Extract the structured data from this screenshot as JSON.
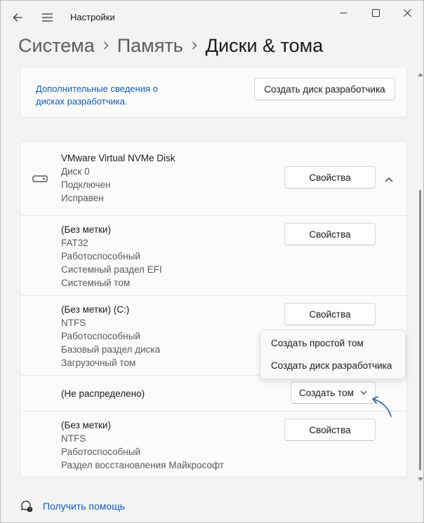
{
  "window": {
    "title": "Настройки"
  },
  "breadcrumb": {
    "items": [
      "Система",
      "Память"
    ],
    "current": "Диски & тома"
  },
  "dev_drive_card": {
    "link_text": "Дополнительные сведения о дисках разработчика.",
    "button_label": "Создать диск разработчика"
  },
  "disk": {
    "name": "VMware Virtual NVMe Disk",
    "number": "Диск 0",
    "status": "Подключен",
    "health": "Исправен",
    "properties_label": "Свойства",
    "partitions": [
      {
        "label": "(Без метки)",
        "fs": "FAT32",
        "status": "Работоспособный",
        "type": "Системный раздел EFI",
        "role": "Системный том",
        "button": "Свойства"
      },
      {
        "label": "(Без метки) (C:)",
        "fs": "NTFS",
        "status": "Работоспособный",
        "type": "Базовый раздел диска",
        "role": "Загрузочный том",
        "button": "Свойства"
      },
      {
        "label": "(Не распределено)",
        "button": "Создать том"
      },
      {
        "label": "(Без метки)",
        "fs": "NTFS",
        "status": "Работоспособный",
        "type": "Раздел восстановления Майкрософт",
        "button": "Свойства"
      }
    ]
  },
  "create_menu": {
    "items": [
      "Создать простой том",
      "Создать диск разработчика"
    ]
  },
  "footer": {
    "help_label": "Получить помощь"
  },
  "colors": {
    "accent": "#0f5ab8",
    "annotation_arrow": "#3d6fa8"
  },
  "icons": [
    "back-arrow-icon",
    "hamburger-menu-icon",
    "minimize-icon",
    "maximize-icon",
    "close-icon",
    "chevron-right-icon",
    "disk-drive-icon",
    "chevron-up-icon",
    "chevron-down-icon",
    "help-icon"
  ]
}
